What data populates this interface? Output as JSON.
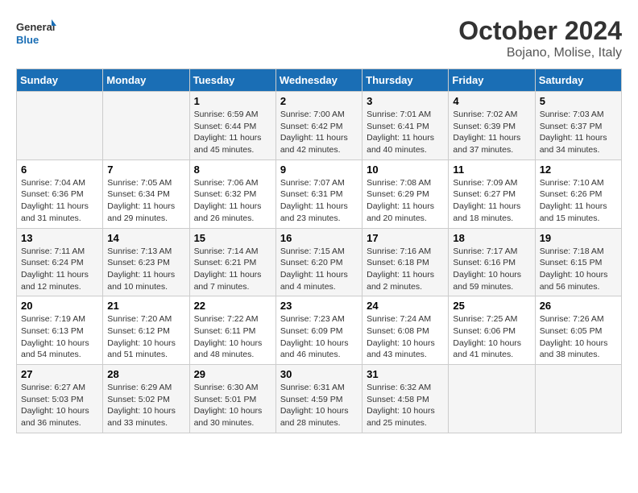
{
  "logo": {
    "line1": "General",
    "line2": "Blue"
  },
  "title": "October 2024",
  "location": "Bojano, Molise, Italy",
  "days_of_week": [
    "Sunday",
    "Monday",
    "Tuesday",
    "Wednesday",
    "Thursday",
    "Friday",
    "Saturday"
  ],
  "weeks": [
    [
      {
        "day": "",
        "info": ""
      },
      {
        "day": "",
        "info": ""
      },
      {
        "day": "1",
        "info": "Sunrise: 6:59 AM\nSunset: 6:44 PM\nDaylight: 11 hours and 45 minutes."
      },
      {
        "day": "2",
        "info": "Sunrise: 7:00 AM\nSunset: 6:42 PM\nDaylight: 11 hours and 42 minutes."
      },
      {
        "day": "3",
        "info": "Sunrise: 7:01 AM\nSunset: 6:41 PM\nDaylight: 11 hours and 40 minutes."
      },
      {
        "day": "4",
        "info": "Sunrise: 7:02 AM\nSunset: 6:39 PM\nDaylight: 11 hours and 37 minutes."
      },
      {
        "day": "5",
        "info": "Sunrise: 7:03 AM\nSunset: 6:37 PM\nDaylight: 11 hours and 34 minutes."
      }
    ],
    [
      {
        "day": "6",
        "info": "Sunrise: 7:04 AM\nSunset: 6:36 PM\nDaylight: 11 hours and 31 minutes."
      },
      {
        "day": "7",
        "info": "Sunrise: 7:05 AM\nSunset: 6:34 PM\nDaylight: 11 hours and 29 minutes."
      },
      {
        "day": "8",
        "info": "Sunrise: 7:06 AM\nSunset: 6:32 PM\nDaylight: 11 hours and 26 minutes."
      },
      {
        "day": "9",
        "info": "Sunrise: 7:07 AM\nSunset: 6:31 PM\nDaylight: 11 hours and 23 minutes."
      },
      {
        "day": "10",
        "info": "Sunrise: 7:08 AM\nSunset: 6:29 PM\nDaylight: 11 hours and 20 minutes."
      },
      {
        "day": "11",
        "info": "Sunrise: 7:09 AM\nSunset: 6:27 PM\nDaylight: 11 hours and 18 minutes."
      },
      {
        "day": "12",
        "info": "Sunrise: 7:10 AM\nSunset: 6:26 PM\nDaylight: 11 hours and 15 minutes."
      }
    ],
    [
      {
        "day": "13",
        "info": "Sunrise: 7:11 AM\nSunset: 6:24 PM\nDaylight: 11 hours and 12 minutes."
      },
      {
        "day": "14",
        "info": "Sunrise: 7:13 AM\nSunset: 6:23 PM\nDaylight: 11 hours and 10 minutes."
      },
      {
        "day": "15",
        "info": "Sunrise: 7:14 AM\nSunset: 6:21 PM\nDaylight: 11 hours and 7 minutes."
      },
      {
        "day": "16",
        "info": "Sunrise: 7:15 AM\nSunset: 6:20 PM\nDaylight: 11 hours and 4 minutes."
      },
      {
        "day": "17",
        "info": "Sunrise: 7:16 AM\nSunset: 6:18 PM\nDaylight: 11 hours and 2 minutes."
      },
      {
        "day": "18",
        "info": "Sunrise: 7:17 AM\nSunset: 6:16 PM\nDaylight: 10 hours and 59 minutes."
      },
      {
        "day": "19",
        "info": "Sunrise: 7:18 AM\nSunset: 6:15 PM\nDaylight: 10 hours and 56 minutes."
      }
    ],
    [
      {
        "day": "20",
        "info": "Sunrise: 7:19 AM\nSunset: 6:13 PM\nDaylight: 10 hours and 54 minutes."
      },
      {
        "day": "21",
        "info": "Sunrise: 7:20 AM\nSunset: 6:12 PM\nDaylight: 10 hours and 51 minutes."
      },
      {
        "day": "22",
        "info": "Sunrise: 7:22 AM\nSunset: 6:11 PM\nDaylight: 10 hours and 48 minutes."
      },
      {
        "day": "23",
        "info": "Sunrise: 7:23 AM\nSunset: 6:09 PM\nDaylight: 10 hours and 46 minutes."
      },
      {
        "day": "24",
        "info": "Sunrise: 7:24 AM\nSunset: 6:08 PM\nDaylight: 10 hours and 43 minutes."
      },
      {
        "day": "25",
        "info": "Sunrise: 7:25 AM\nSunset: 6:06 PM\nDaylight: 10 hours and 41 minutes."
      },
      {
        "day": "26",
        "info": "Sunrise: 7:26 AM\nSunset: 6:05 PM\nDaylight: 10 hours and 38 minutes."
      }
    ],
    [
      {
        "day": "27",
        "info": "Sunrise: 6:27 AM\nSunset: 5:03 PM\nDaylight: 10 hours and 36 minutes."
      },
      {
        "day": "28",
        "info": "Sunrise: 6:29 AM\nSunset: 5:02 PM\nDaylight: 10 hours and 33 minutes."
      },
      {
        "day": "29",
        "info": "Sunrise: 6:30 AM\nSunset: 5:01 PM\nDaylight: 10 hours and 30 minutes."
      },
      {
        "day": "30",
        "info": "Sunrise: 6:31 AM\nSunset: 4:59 PM\nDaylight: 10 hours and 28 minutes."
      },
      {
        "day": "31",
        "info": "Sunrise: 6:32 AM\nSunset: 4:58 PM\nDaylight: 10 hours and 25 minutes."
      },
      {
        "day": "",
        "info": ""
      },
      {
        "day": "",
        "info": ""
      }
    ]
  ]
}
